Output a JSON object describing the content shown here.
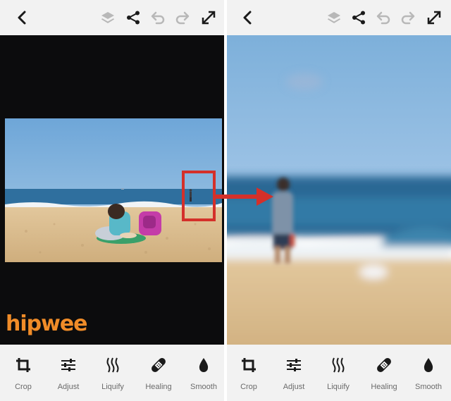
{
  "left_panel": {
    "toolbar_icons": [
      "back-chevron-icon",
      "layers-icon",
      "share-icon",
      "undo-icon",
      "redo-icon",
      "expand-icon"
    ],
    "watermark": "hipwee",
    "tools": [
      {
        "label": "Crop",
        "icon": "crop-icon"
      },
      {
        "label": "Adjust",
        "icon": "adjust-sliders-icon"
      },
      {
        "label": "Liquify",
        "icon": "liquify-icon"
      },
      {
        "label": "Healing",
        "icon": "healing-bandage-icon"
      },
      {
        "label": "Smooth",
        "icon": "smooth-drop-icon"
      }
    ]
  },
  "right_panel": {
    "toolbar_icons": [
      "back-chevron-icon",
      "layers-icon",
      "share-icon",
      "undo-icon",
      "redo-icon",
      "expand-icon"
    ],
    "tools": [
      {
        "label": "Crop",
        "icon": "crop-icon"
      },
      {
        "label": "Adjust",
        "icon": "adjust-sliders-icon"
      },
      {
        "label": "Liquify",
        "icon": "liquify-icon"
      },
      {
        "label": "Healing",
        "icon": "healing-bandage-icon"
      },
      {
        "label": "Smooth",
        "icon": "smooth-drop-icon"
      }
    ]
  },
  "colors": {
    "toolbar_bg": "#f2f2f2",
    "icon_active": "#1a1a1a",
    "icon_disabled": "#b8b8b8",
    "canvas_bg": "#0c0c0d",
    "highlight": "#d4302a",
    "watermark": "#f08c28",
    "sky": "#7fb2de",
    "sea": "#2d6c9c",
    "sand": "#d8bb8e"
  }
}
